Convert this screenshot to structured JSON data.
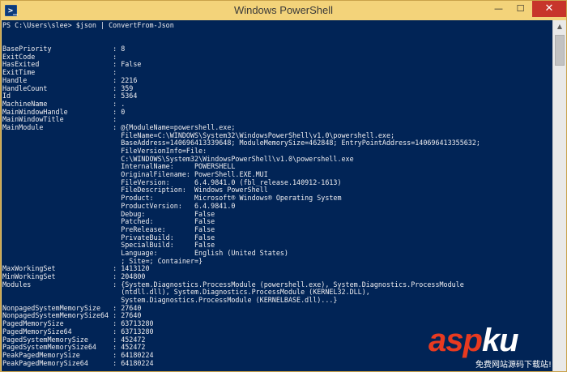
{
  "window": {
    "title": "Windows PowerShell",
    "icon": "powershell-icon",
    "controls": {
      "minimize": "—",
      "maximize": "☐",
      "close": "✕"
    }
  },
  "console": {
    "lines": [
      "PS C:\\Users\\slee> $json | ConvertFrom-Json",
      "",
      "",
      "BasePriority               : 8",
      "ExitCode                   :",
      "HasExited                  : False",
      "ExitTime                   :",
      "Handle                     : 2216",
      "HandleCount                : 359",
      "Id                         : 5364",
      "MachineName                : .",
      "MainWindowHandle           : 0",
      "MainWindowTitle            :",
      "MainModule                 : @{ModuleName=powershell.exe;",
      "                             FileName=C:\\WINDOWS\\System32\\WindowsPowerShell\\v1.0\\powershell.exe;",
      "                             BaseAddress=140696413339648; ModuleMemorySize=462848; EntryPointAddress=140696413355632;",
      "                             FileVersionInfo=File:",
      "                             C:\\WINDOWS\\System32\\WindowsPowerShell\\v1.0\\powershell.exe",
      "                             InternalName:     POWERSHELL",
      "                             OriginalFilename: PowerShell.EXE.MUI",
      "                             FileVersion:      6.4.9841.0 (fbl_release.140912-1613)",
      "                             FileDescription:  Windows PowerShell",
      "                             Product:          Microsoft® Windows® Operating System",
      "                             ProductVersion:   6.4.9841.0",
      "                             Debug:            False",
      "                             Patched:          False",
      "                             PreRelease:       False",
      "                             PrivateBuild:     False",
      "                             SpecialBuild:     False",
      "                             Language:         English (United States)",
      "                             ; Site=; Container=}",
      "MaxWorkingSet              : 1413120",
      "MinWorkingSet              : 204800",
      "Modules                    : {System.Diagnostics.ProcessModule (powershell.exe), System.Diagnostics.ProcessModule",
      "                             (ntdll.dll), System.Diagnostics.ProcessModule (KERNEL32.DLL),",
      "                             System.Diagnostics.ProcessModule (KERNELBASE.dll)...}",
      "NonpagedSystemMemorySize   : 27640",
      "NonpagedSystemMemorySize64 : 27640",
      "PagedMemorySize            : 63713280",
      "PagedMemorySize64          : 63713280",
      "PagedSystemMemorySize      : 452472",
      "PagedSystemMemorySize64    : 452472",
      "PeakPagedMemorySize        : 64180224",
      "PeakPagedMemorySize64      : 64180224"
    ]
  },
  "scrollbar": {
    "up_arrow": "▲"
  },
  "watermark": {
    "brand_part1": "asp",
    "brand_part2": "ku",
    "brand_tld": ".com",
    "tagline": "免费网站源码下载站!"
  },
  "colors": {
    "console_background": "#012456",
    "console_text": "#eeedf0",
    "titlebar": "#f3d37a",
    "close_button": "#c7352b",
    "watermark_accent": "#e83a20"
  }
}
